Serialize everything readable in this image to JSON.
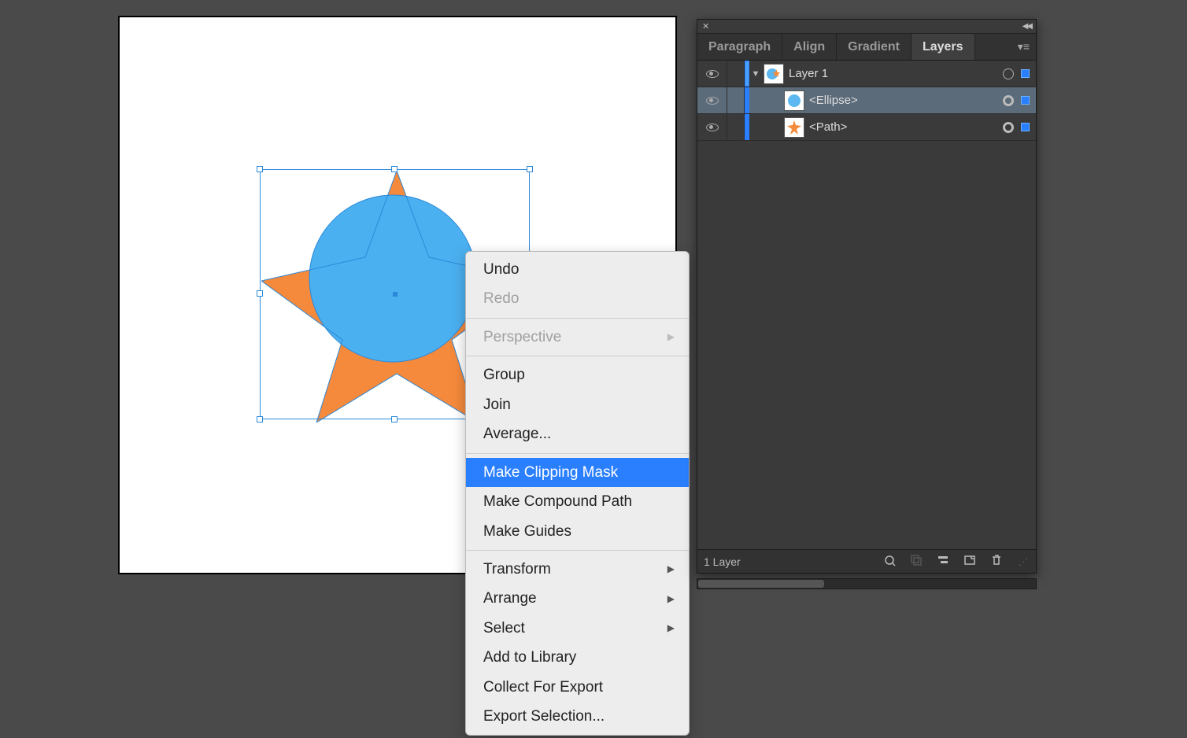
{
  "canvas": {
    "selection": {
      "centerColor": "#2b88d8"
    }
  },
  "context_menu": {
    "items": [
      {
        "label": "Undo",
        "enabled": true
      },
      {
        "label": "Redo",
        "enabled": false
      },
      {
        "sep": true
      },
      {
        "label": "Perspective",
        "enabled": false,
        "submenu": true
      },
      {
        "sep": true
      },
      {
        "label": "Group",
        "enabled": true
      },
      {
        "label": "Join",
        "enabled": true
      },
      {
        "label": "Average...",
        "enabled": true
      },
      {
        "sep": true
      },
      {
        "label": "Make Clipping Mask",
        "enabled": true,
        "highlight": true
      },
      {
        "label": "Make Compound Path",
        "enabled": true
      },
      {
        "label": "Make Guides",
        "enabled": true
      },
      {
        "sep": true
      },
      {
        "label": "Transform",
        "enabled": true,
        "submenu": true
      },
      {
        "label": "Arrange",
        "enabled": true,
        "submenu": true
      },
      {
        "label": "Select",
        "enabled": true,
        "submenu": true
      },
      {
        "label": "Add to Library",
        "enabled": true
      },
      {
        "label": "Collect For Export",
        "enabled": true
      },
      {
        "label": "Export Selection...",
        "enabled": true
      }
    ]
  },
  "panel": {
    "tabs": [
      {
        "label": "Paragraph",
        "active": false
      },
      {
        "label": "Align",
        "active": false
      },
      {
        "label": "Gradient",
        "active": false
      },
      {
        "label": "Layers",
        "active": true
      }
    ],
    "layers": {
      "root": {
        "name": "Layer 1",
        "expanded": true
      },
      "children": [
        {
          "name": "<Ellipse>",
          "thumb": "ellipse",
          "selected": true,
          "targeted": true
        },
        {
          "name": "<Path>",
          "thumb": "star",
          "selected": false,
          "targeted": true
        }
      ]
    },
    "footer": {
      "count_label": "1 Layer"
    }
  }
}
